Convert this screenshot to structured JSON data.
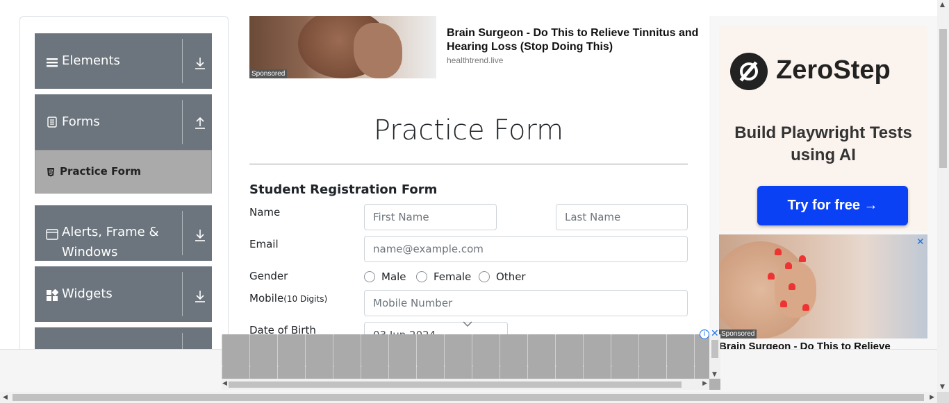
{
  "sidebar": {
    "groups": [
      {
        "label": "Elements",
        "icon": "hamburger-icon",
        "arrow": "download-arrow-icon"
      },
      {
        "label": "Forms",
        "icon": "document-icon",
        "arrow": "upload-arrow-icon"
      },
      {
        "label": "Alerts, Frame & Windows",
        "icon": "window-icon",
        "arrow": "download-arrow-icon"
      },
      {
        "label": "Widgets",
        "icon": "widgets-icon",
        "arrow": "download-arrow-icon"
      }
    ],
    "active_item": {
      "label": "Practice Form",
      "icon": "html-icon"
    }
  },
  "top_ad": {
    "sponsored": "Sponsored",
    "headline": "Brain Surgeon - Do This to Relieve Tinnitus and Hearing Loss (Stop Doing This)",
    "source": "healthtrend.live"
  },
  "form": {
    "title": "Practice Form",
    "subtitle": "Student Registration Form",
    "name_label": "Name",
    "first_name_placeholder": "First Name",
    "last_name_placeholder": "Last Name",
    "email_label": "Email",
    "email_placeholder": "name@example.com",
    "gender_label": "Gender",
    "gender_options": [
      "Male",
      "Female",
      "Other"
    ],
    "mobile_label": "Mobile",
    "mobile_hint": "(10 Digits)",
    "mobile_placeholder": "Mobile Number",
    "dob_label": "Date of Birth",
    "dob_value": "03 Jun 2024"
  },
  "right_ad": {
    "brand": "ZeroStep",
    "tagline": "Build Playwright Tests using AI",
    "cta": "Try for free →",
    "close": "✕",
    "sponsored": "Sponsored",
    "headline2": "Brain Surgeon - Do This to Relieve"
  },
  "bottom_ad": {
    "info": "i",
    "close": "✕"
  },
  "colors": {
    "sidebar_group": "#6c757d",
    "active_item": "#aaaaaa",
    "cta": "#0b41f5"
  }
}
